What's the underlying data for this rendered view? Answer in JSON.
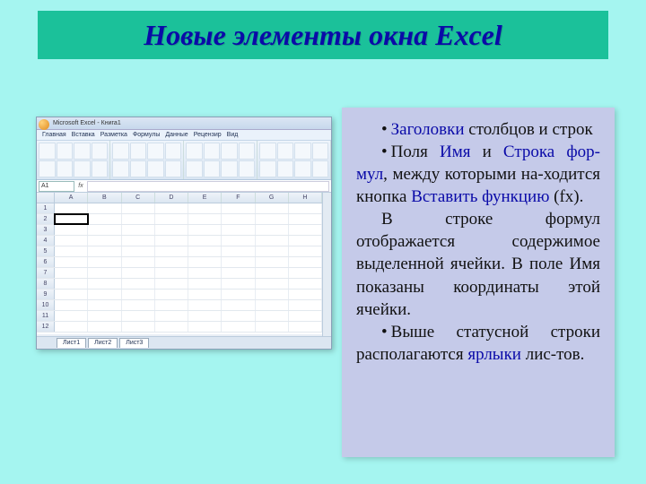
{
  "title": "Новые элементы окна Excel",
  "excel": {
    "app_title": "Microsoft Excel - Книга1",
    "menus": [
      "Главная",
      "Вставка",
      "Разметка",
      "Формулы",
      "Данные",
      "Рецензир",
      "Вид"
    ],
    "name_box": "A1",
    "fx_label": "fx",
    "columns": [
      "A",
      "B",
      "C",
      "D",
      "E",
      "F",
      "G",
      "H"
    ],
    "row_count": 12,
    "sheet_tabs": [
      "Лист1",
      "Лист2",
      "Лист3"
    ]
  },
  "bullets": {
    "b1_hl": "Заголовки",
    "b1_rest": " столбцов и строк",
    "b2_a": "Поля ",
    "b2_hl1": "Имя",
    "b2_b": " и ",
    "b2_hl2": "Строка фор-мул",
    "b2_c": ", между которыми на-ходится кнопка ",
    "b2_hl3": "Вставить функцию",
    "b2_d": " (fx).",
    "p3": "В строке формул отображается содержимое выделенной ячейки. В поле Имя показаны координаты этой ячейки.",
    "b4_a": "Выше статусной строки располагаются ",
    "b4_hl": "ярлыки",
    "b4_b": " лис-тов."
  }
}
